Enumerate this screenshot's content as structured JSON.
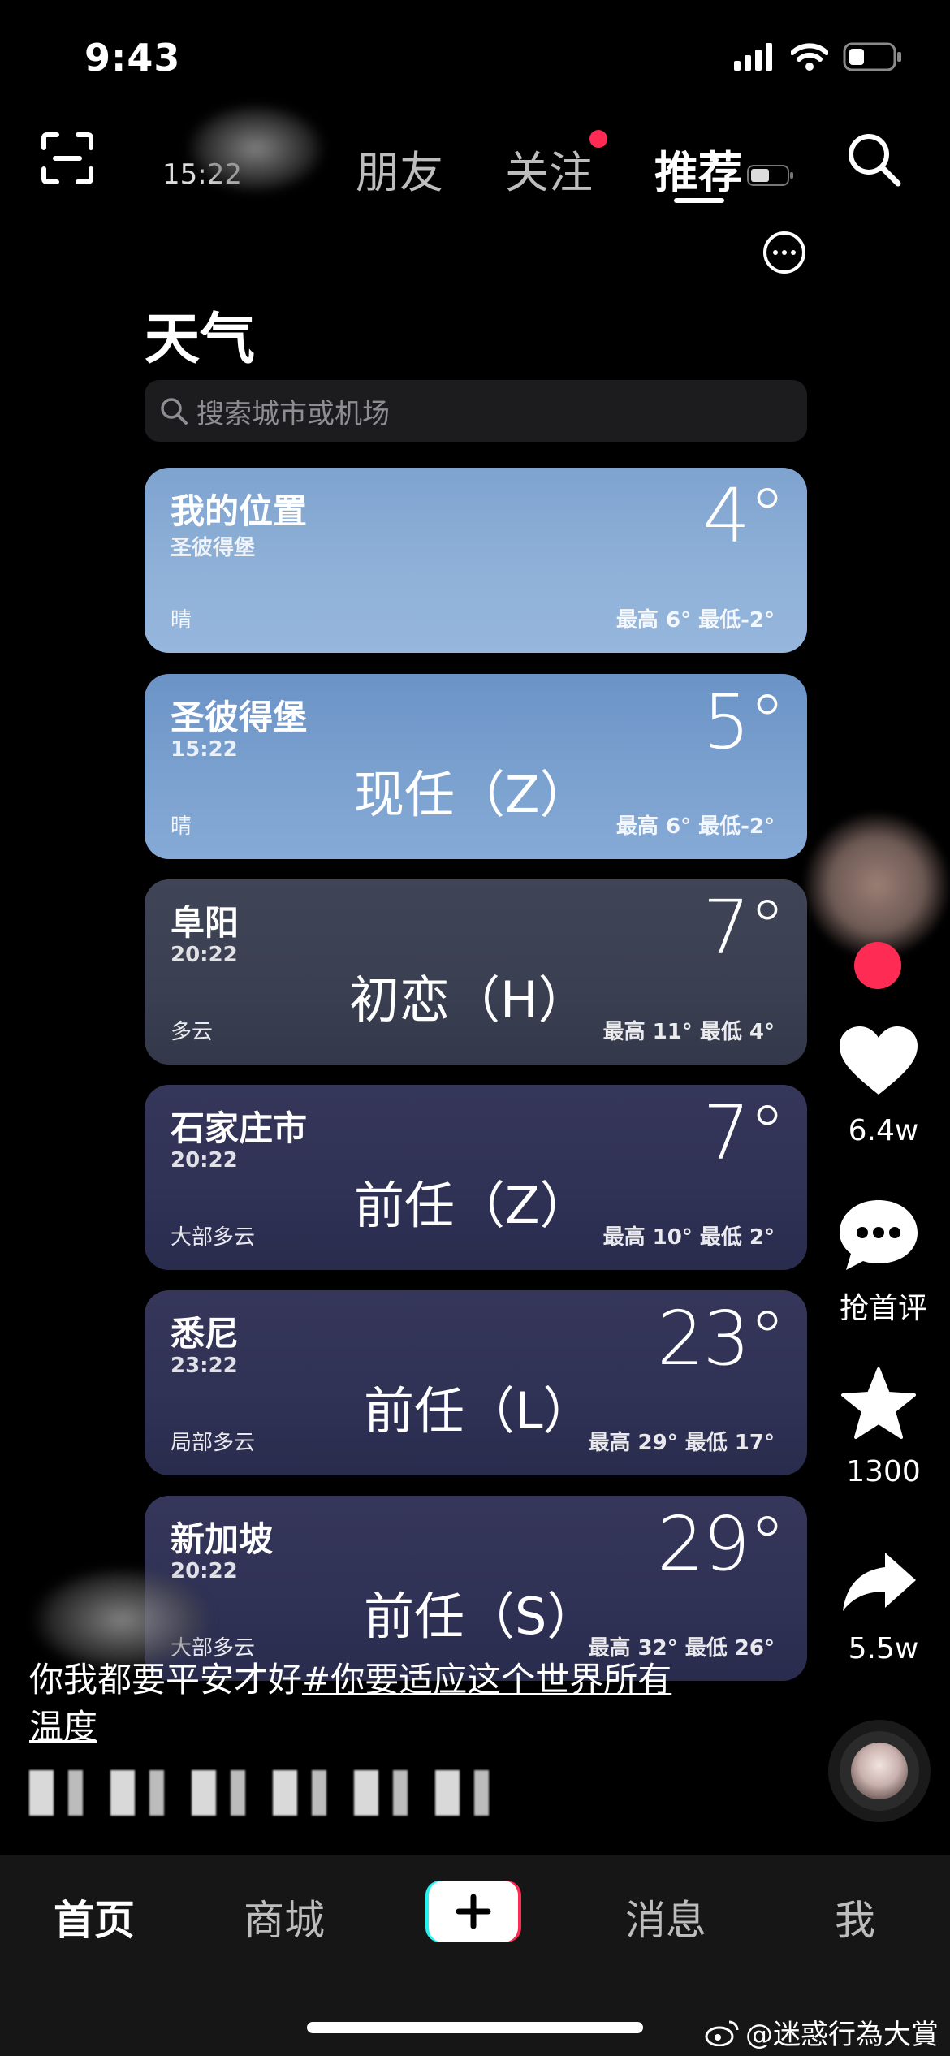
{
  "status_bar": {
    "time": "9:43"
  },
  "top_nav": {
    "blurred_time": "15:22",
    "tabs": [
      {
        "label": "朋友",
        "active": false
      },
      {
        "label": "关注",
        "active": false,
        "has_dot": true
      },
      {
        "label": "推荐",
        "active": true
      }
    ]
  },
  "weather": {
    "title": "天气",
    "search_placeholder": "搜索城市或机场",
    "cards": [
      {
        "city": "我的位置",
        "sub": "圣彼得堡",
        "temp": "4°",
        "condition": "晴",
        "hilo": "最高 6°  最低-2°",
        "overlay": ""
      },
      {
        "city": "圣彼得堡",
        "sub": "15:22",
        "temp": "5°",
        "condition": "晴",
        "hilo": "最高 6°  最低-2°",
        "overlay": "现任（Z）"
      },
      {
        "city": "阜阳",
        "sub": "20:22",
        "temp": "7°",
        "condition": "多云",
        "hilo": "最高 11°  最低 4°",
        "overlay": "初恋（H）"
      },
      {
        "city": "石家庄市",
        "sub": "20:22",
        "temp": "7°",
        "condition": "大部多云",
        "hilo": "最高 10°  最低 2°",
        "overlay": "前任（Z）"
      },
      {
        "city": "悉尼",
        "sub": "23:22",
        "temp": "23°",
        "condition": "局部多云",
        "hilo": "最高 29°  最低 17°",
        "overlay": "前任（L）"
      },
      {
        "city": "新加坡",
        "sub": "20:22",
        "temp": "29°",
        "condition": "大部多云",
        "hilo": "最高 32°  最低 26°",
        "overlay": "前任（S）"
      }
    ]
  },
  "rail": {
    "likes": "6.4w",
    "comments": "抢首评",
    "favorites": "1300",
    "shares": "5.5w"
  },
  "caption": {
    "text": "你我都要平安才好",
    "hashtag": "#你要适应这个世界所有温度"
  },
  "bottom_nav": {
    "items": [
      "首页",
      "商城",
      "消息",
      "我"
    ],
    "active": "首页"
  },
  "watermark": "@迷惑行為大賞",
  "colors": {
    "accent_red": "#fe2c55",
    "plus_cyan": "#25f4ee"
  }
}
